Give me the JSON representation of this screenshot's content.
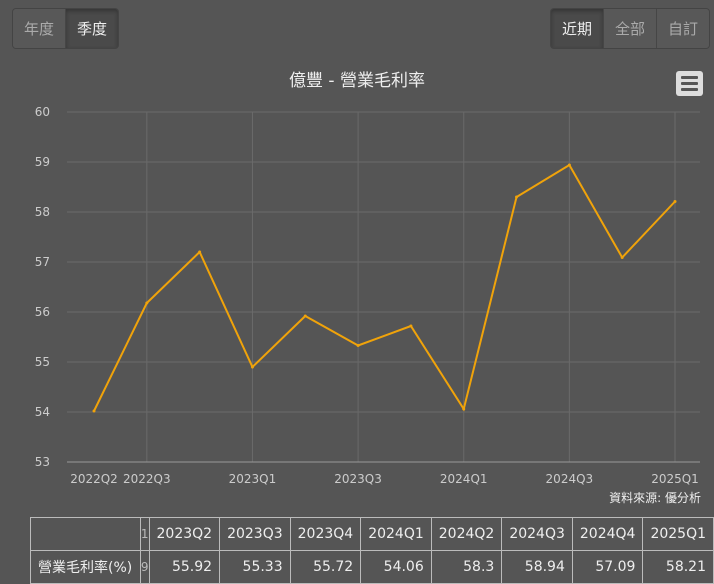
{
  "period_toggle": [
    {
      "label": "年度",
      "active": false
    },
    {
      "label": "季度",
      "active": true
    }
  ],
  "range_toggle": [
    {
      "label": "近期",
      "active": true
    },
    {
      "label": "全部",
      "active": false
    },
    {
      "label": "自訂",
      "active": false
    }
  ],
  "menu_icon": "hamburger-menu-icon",
  "source": "資料來源: 優分析",
  "colors": {
    "line": "#f0a30a",
    "grid": "#6a6a6a"
  },
  "chart_data": {
    "type": "line",
    "title": "億豐 - 營業毛利率",
    "x": [
      "2022Q2",
      "2022Q3",
      "2022Q4",
      "2023Q1",
      "2023Q2",
      "2023Q3",
      "2023Q4",
      "2024Q1",
      "2024Q2",
      "2024Q3",
      "2024Q4",
      "2025Q1"
    ],
    "xtick_labels": [
      "2022Q2",
      "2022Q3",
      "2023Q1",
      "2023Q3",
      "2024Q1",
      "2024Q3",
      "2025Q1"
    ],
    "series": [
      {
        "name": "營業毛利率(%)",
        "values": [
          54.02,
          56.18,
          57.2,
          54.9,
          55.92,
          55.33,
          55.72,
          54.06,
          58.3,
          58.94,
          57.09,
          58.21
        ]
      }
    ],
    "ylim": [
      53,
      60
    ],
    "yticks": [
      53,
      54,
      55,
      56,
      57,
      58,
      59,
      60
    ],
    "grid": true
  },
  "table": {
    "row_label": "營業毛利率(%)",
    "partial_header": "1",
    "partial_value": "9",
    "headers": [
      "2023Q2",
      "2023Q3",
      "2023Q4",
      "2024Q1",
      "2024Q2",
      "2024Q3",
      "2024Q4",
      "2025Q1"
    ],
    "values": [
      "55.92",
      "55.33",
      "55.72",
      "54.06",
      "58.3",
      "58.94",
      "57.09",
      "58.21"
    ]
  }
}
